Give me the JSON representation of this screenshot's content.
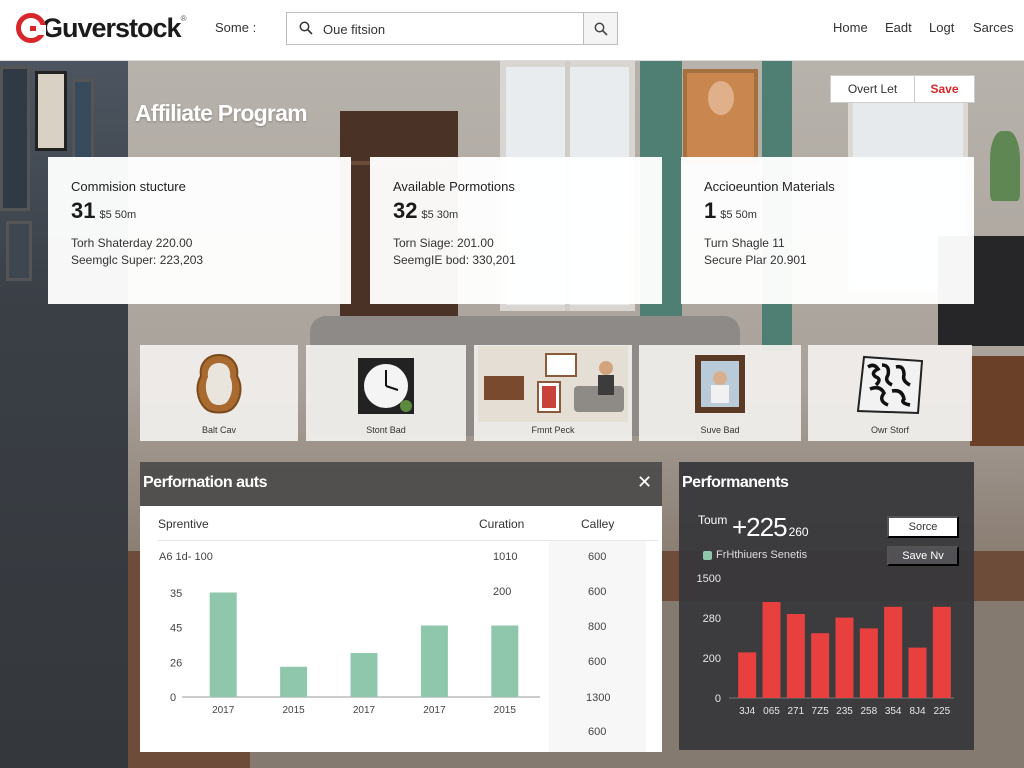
{
  "header": {
    "logo": "Guverstock",
    "trademark": "®",
    "menu_label": "Some :",
    "search": {
      "value": "Oue fitsion"
    },
    "nav": [
      "Home",
      "Eadt",
      "Logt",
      "Sarces"
    ]
  },
  "page": {
    "title": "Affiliate Program",
    "actions": {
      "secondary": "Overt Let",
      "primary": "Save"
    }
  },
  "stat_cards": [
    {
      "title": "Commision stucture",
      "value": "31",
      "value_suffix": "$5 50m",
      "line1": "Torh Shaterday 220.00",
      "line2": "Seemglc Super: 223,203"
    },
    {
      "title": "Available Pormotions",
      "value": "32",
      "value_suffix": "$5 30m",
      "line1": "Torn Siage: 201.00",
      "line2": "SeemgIE bod: 330,201"
    },
    {
      "title": "Accioeuntion Materials",
      "value": "1",
      "value_suffix": "$5 50m",
      "line1": "Turn Shagle 11",
      "line2": "Secure Plar 20.901"
    }
  ],
  "tiles": [
    {
      "caption": "Balt Cav",
      "icon": "mirror-icon"
    },
    {
      "caption": "Stont Bad",
      "icon": "clock-icon"
    },
    {
      "caption": "Fmnt Peck",
      "icon": "room-photo-icon"
    },
    {
      "caption": "Suve Bad",
      "icon": "portrait-frame-icon"
    },
    {
      "caption": "Owr Storf",
      "icon": "poster-icon"
    }
  ],
  "performance_left": {
    "title": "Perfornation auts",
    "close_icon": "close-icon",
    "columns": [
      "Sprentive",
      "Curation",
      "Calley"
    ],
    "y_header": "A6 1d- 100",
    "col2_values": [
      "1010",
      "200"
    ],
    "col3_values": [
      "600",
      "600",
      "800",
      "600",
      "1300",
      "600"
    ]
  },
  "performance_right": {
    "title": "Performanents",
    "total_label": "Toum",
    "total_value": "+225",
    "total_suffix": "260",
    "legend": "FrHthiuers Senetis",
    "buttons": {
      "sorce": "Sorce",
      "save_nv": "Save Nv"
    }
  },
  "chart_data": [
    {
      "type": "bar",
      "categories": [
        "2017",
        "2015",
        "2017",
        "2017",
        "2015"
      ],
      "y_tick_labels": [
        "35",
        "45",
        "26",
        "0"
      ],
      "values": [
        38,
        11,
        16,
        26,
        26
      ],
      "ylim": [
        0,
        40
      ],
      "color": "#8fc7ad"
    },
    {
      "type": "bar",
      "categories": [
        "3J4",
        "065",
        "271",
        "7Z5",
        "235",
        "258",
        "354",
        "8J4",
        "225"
      ],
      "y_tick_labels": [
        "1500",
        "280",
        "200",
        "0"
      ],
      "values": [
        190,
        400,
        350,
        270,
        335,
        290,
        380,
        210,
        380
      ],
      "ylim": [
        0,
        500
      ],
      "color": "#e8403f"
    }
  ]
}
